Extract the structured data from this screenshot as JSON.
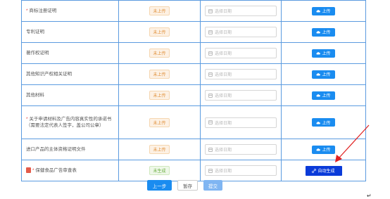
{
  "rows": [
    {
      "required": "*",
      "name": "商标注册证明",
      "status": "未上传",
      "status_type": "up",
      "date_placeholder": "选择日期",
      "action": "上传",
      "action_type": "upload"
    },
    {
      "required": "",
      "name": "专利证明",
      "status": "未上传",
      "status_type": "up",
      "date_placeholder": "选择日期",
      "action": "上传",
      "action_type": "upload"
    },
    {
      "required": "",
      "name": "著作权证明",
      "status": "未上传",
      "status_type": "up",
      "date_placeholder": "选择日期",
      "action": "上传",
      "action_type": "upload"
    },
    {
      "required": "",
      "name": "其他知识产权相关证明",
      "status": "未上传",
      "status_type": "up",
      "date_placeholder": "选择日期",
      "action": "上传",
      "action_type": "upload"
    },
    {
      "required": "",
      "name": "其他材料",
      "status": "未上传",
      "status_type": "up",
      "date_placeholder": "选择日期",
      "action": "上传",
      "action_type": "upload"
    },
    {
      "required": "*",
      "name": "关于申请材料及广告内容真实性的承诺书（需要法定代表人签字，盖公司公章）",
      "status": "未上传",
      "status_type": "up",
      "date_placeholder": "选择日期",
      "action": "上传",
      "action_type": "upload"
    },
    {
      "required": "",
      "name": "进口产品的主体资格证明文件",
      "status": "未上传",
      "status_type": "up",
      "date_placeholder": "选择日期",
      "action": "上传",
      "action_type": "upload"
    },
    {
      "required": "*",
      "name": "保健食品广告审查表",
      "status": "未生成",
      "status_type": "gen",
      "date_placeholder": "选择日期",
      "action": "自动生成",
      "action_type": "auto"
    }
  ],
  "footer": {
    "prev": "上一步",
    "save": "暂存",
    "submit": "提交"
  },
  "return_mark": "↵",
  "colors": {
    "primary": "#1a8cf0",
    "auto_button": "#0a3bd9",
    "arrow": "#e02020",
    "border": "#5b9be0"
  },
  "icons": {
    "upload": "cloud-upload-icon",
    "auto": "link-icon",
    "date": "calendar-icon",
    "file": "pdf-icon"
  }
}
